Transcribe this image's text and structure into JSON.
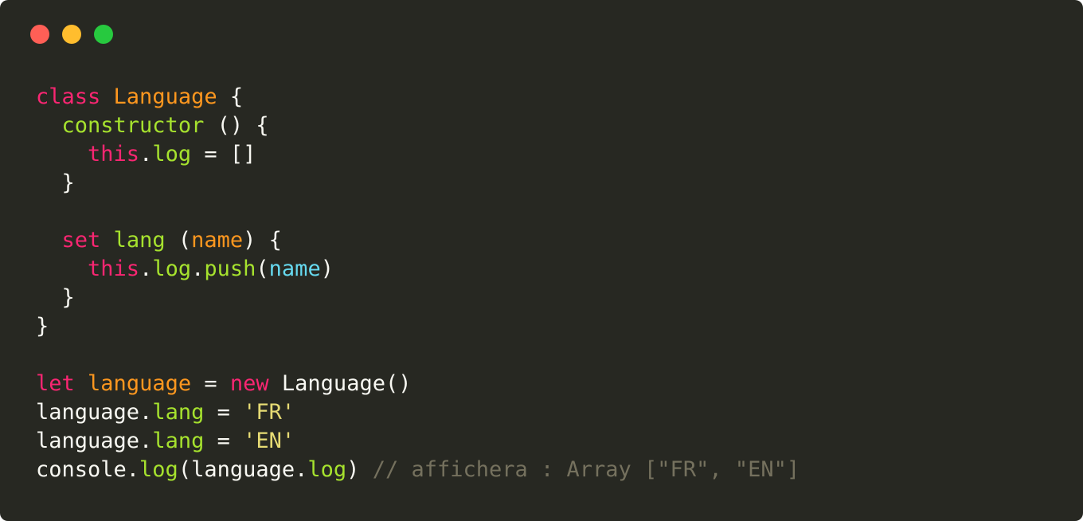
{
  "window": {
    "controls": [
      {
        "name": "close",
        "color": "#ff5f56"
      },
      {
        "name": "minimize",
        "color": "#ffbd2e"
      },
      {
        "name": "maximize",
        "color": "#27c93f"
      }
    ]
  },
  "colors": {
    "background": "#272822",
    "plain": "#f8f8f2",
    "keyword": "#f92672",
    "class": "#fd971f",
    "func": "#a6e22e",
    "arg": "#66d9ef",
    "string": "#e6db74",
    "comment": "#75715e"
  },
  "code": {
    "lines": [
      [
        [
          "keyword",
          "class"
        ],
        [
          "plain",
          " "
        ],
        [
          "class",
          "Language"
        ],
        [
          "plain",
          " {"
        ]
      ],
      [
        [
          "plain",
          "  "
        ],
        [
          "func",
          "constructor"
        ],
        [
          "plain",
          " () {"
        ]
      ],
      [
        [
          "plain",
          "    "
        ],
        [
          "keyword",
          "this"
        ],
        [
          "plain",
          "."
        ],
        [
          "func",
          "log"
        ],
        [
          "plain",
          " = []"
        ]
      ],
      [
        [
          "plain",
          "  }"
        ]
      ],
      [],
      [
        [
          "plain",
          "  "
        ],
        [
          "keyword",
          "set"
        ],
        [
          "plain",
          " "
        ],
        [
          "func",
          "lang"
        ],
        [
          "plain",
          " ("
        ],
        [
          "param",
          "name"
        ],
        [
          "plain",
          ") {"
        ]
      ],
      [
        [
          "plain",
          "    "
        ],
        [
          "keyword",
          "this"
        ],
        [
          "plain",
          "."
        ],
        [
          "func",
          "log"
        ],
        [
          "plain",
          "."
        ],
        [
          "func",
          "push"
        ],
        [
          "plain",
          "("
        ],
        [
          "arg",
          "name"
        ],
        [
          "plain",
          ")"
        ]
      ],
      [
        [
          "plain",
          "  }"
        ]
      ],
      [
        [
          "plain",
          "}"
        ]
      ],
      [],
      [
        [
          "keyword",
          "let"
        ],
        [
          "plain",
          " "
        ],
        [
          "var",
          "language"
        ],
        [
          "plain",
          " = "
        ],
        [
          "keyword",
          "new"
        ],
        [
          "plain",
          " Language()"
        ]
      ],
      [
        [
          "plain",
          "language."
        ],
        [
          "func",
          "lang"
        ],
        [
          "plain",
          " = "
        ],
        [
          "string",
          "'FR'"
        ]
      ],
      [
        [
          "plain",
          "language."
        ],
        [
          "func",
          "lang"
        ],
        [
          "plain",
          " = "
        ],
        [
          "string",
          "'EN'"
        ]
      ],
      [
        [
          "plain",
          "console."
        ],
        [
          "func",
          "log"
        ],
        [
          "plain",
          "(language."
        ],
        [
          "func",
          "log"
        ],
        [
          "plain",
          ") "
        ],
        [
          "comment",
          "// affichera : Array [\"FR\", \"EN\"]"
        ]
      ]
    ]
  }
}
